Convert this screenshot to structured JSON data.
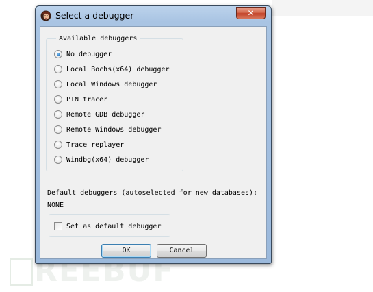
{
  "dialog": {
    "title": "Select a debugger",
    "close_glyph": "✕"
  },
  "available": {
    "legend": "Available debuggers",
    "selected": "No debugger",
    "options": [
      "No debugger",
      "Local Bochs(x64) debugger",
      "Local Windows debugger",
      "PIN tracer",
      "Remote GDB debugger",
      "Remote Windows debugger",
      "Trace replayer",
      "Windbg(x64) debugger"
    ]
  },
  "default_info": {
    "label": "Default debuggers (autoselected for new databases):",
    "value": "NONE"
  },
  "set_default": {
    "label": "Set as default debugger",
    "checked": false
  },
  "buttons": {
    "ok": "OK",
    "cancel": "Cancel"
  },
  "background": {
    "watermark": "REEBUF"
  },
  "icons": {
    "app": "app-avatar-icon",
    "close": "close-icon"
  }
}
